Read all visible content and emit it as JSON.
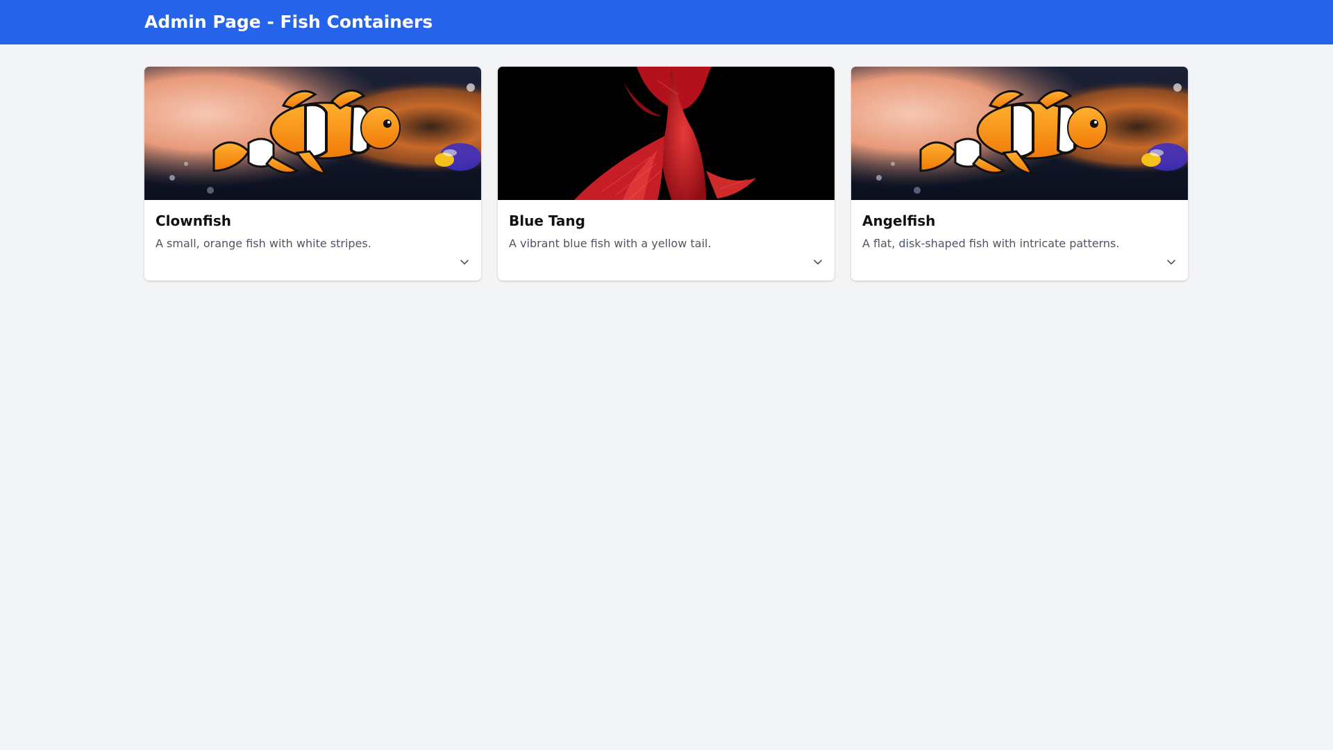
{
  "header": {
    "title": "Admin Page - Fish Containers",
    "color": "#2563eb"
  },
  "cards": [
    {
      "name": "Clownfish",
      "description": "A small, orange fish with white stripes.",
      "image_icon": "clownfish-image",
      "expand_icon": "chevron-down-icon"
    },
    {
      "name": "Blue Tang",
      "description": "A vibrant blue fish with a yellow tail.",
      "image_icon": "betta-fish-image",
      "expand_icon": "chevron-down-icon"
    },
    {
      "name": "Angelfish",
      "description": "A flat, disk-shaped fish with intricate patterns.",
      "image_icon": "clownfish-image",
      "expand_icon": "chevron-down-icon"
    }
  ]
}
